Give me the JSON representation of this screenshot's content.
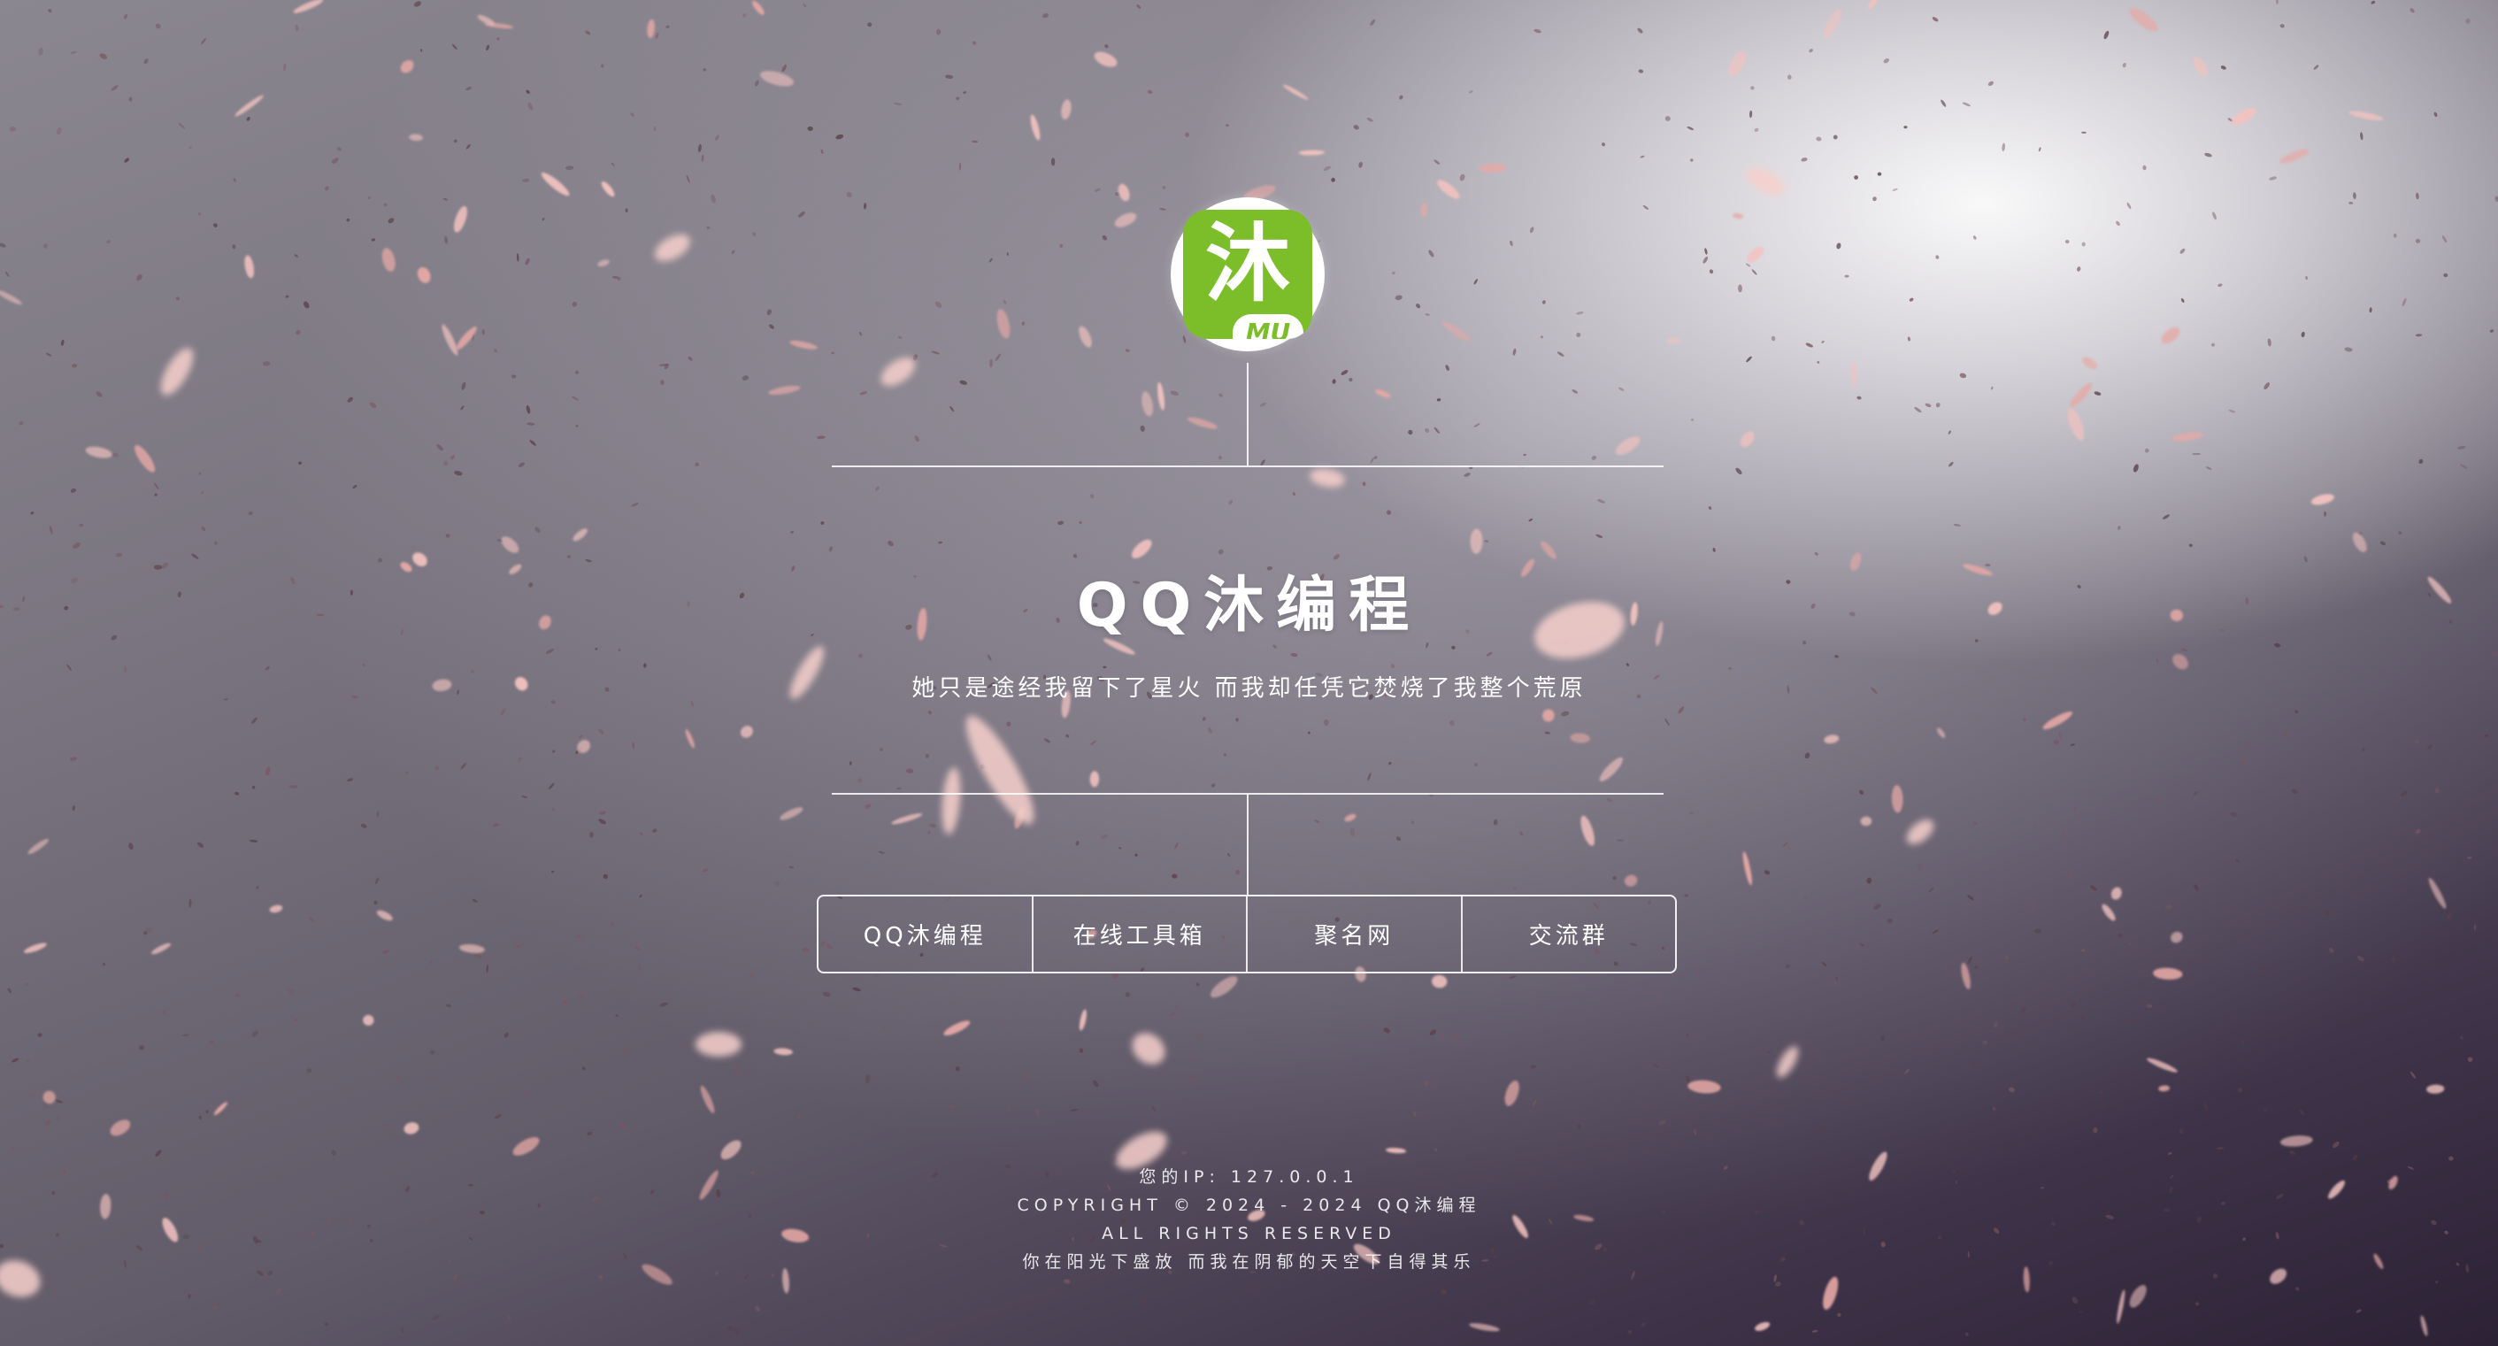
{
  "logo": {
    "char": "沐",
    "badge": "MU"
  },
  "site": {
    "title": "QQ沐编程",
    "subtitle": "她只是途经我留下了星火 而我却任凭它焚烧了我整个荒原"
  },
  "nav": {
    "items": [
      {
        "label": "QQ沐编程"
      },
      {
        "label": "在线工具箱"
      },
      {
        "label": "聚名网"
      },
      {
        "label": "交流群"
      }
    ]
  },
  "footer": {
    "ip": "您的IP: 127.0.0.1",
    "copyright": "COPYRIGHT © 2024 - 2024 QQ沐编程",
    "rights": "ALL RIGHTS RESERVED",
    "motto": "你在阳光下盛放 而我在阴郁的天空下自得其乐"
  },
  "colors": {
    "logo_green": "#7cbd2a",
    "text": "#ffffff",
    "petal": "#f3c3c0"
  }
}
